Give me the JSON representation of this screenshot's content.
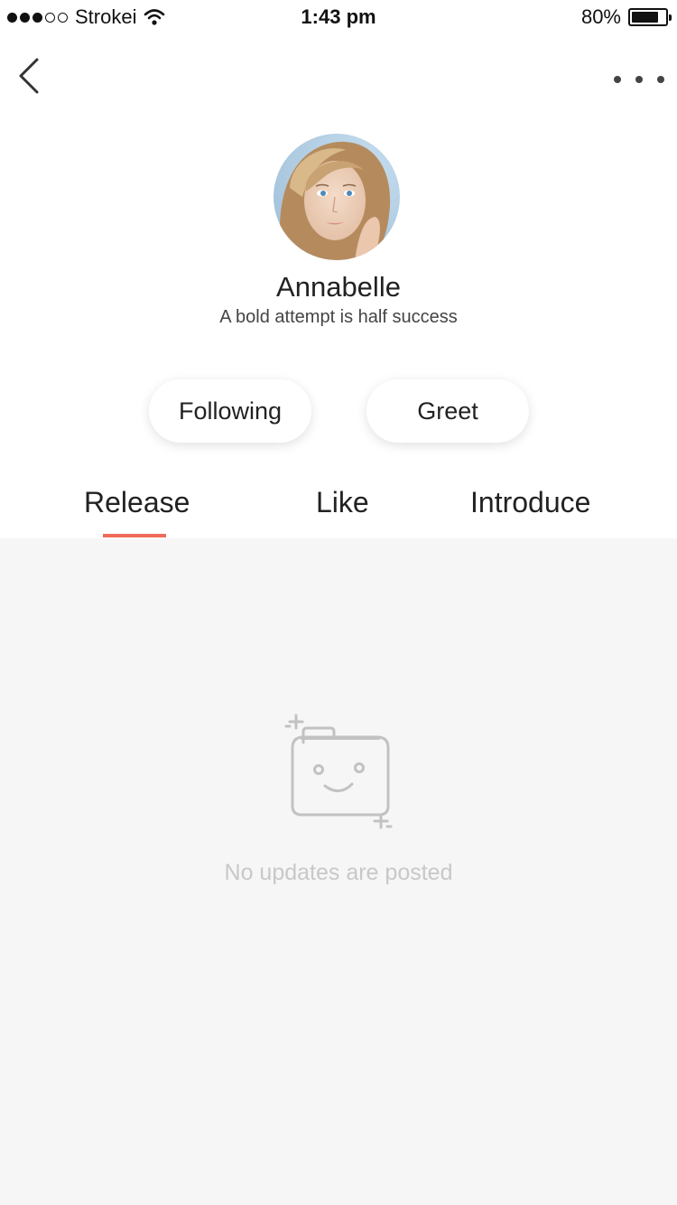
{
  "status_bar": {
    "carrier": "Strokei",
    "time": "1:43 pm",
    "battery": "80%",
    "battery_level": 0.8,
    "signal_bars_filled": 3,
    "signal_bars_total": 5
  },
  "nav": {
    "back_icon": "chevron-left-icon",
    "more_icon": "more-dots-icon"
  },
  "profile": {
    "name": "Annabelle",
    "bio": "A bold attempt is half success"
  },
  "actions": {
    "following_label": "Following",
    "greet_label": "Greet"
  },
  "tabs": [
    {
      "label": "Release",
      "active": true
    },
    {
      "label": "Like",
      "active": false
    },
    {
      "label": "Introduce",
      "active": false
    }
  ],
  "colors": {
    "accent": "#ef6a5b",
    "content_bg": "#f6f6f6",
    "empty_text": "#c8c8c8"
  },
  "empty_state": {
    "icon": "smiling-folder-icon",
    "message": "No updates are posted"
  }
}
